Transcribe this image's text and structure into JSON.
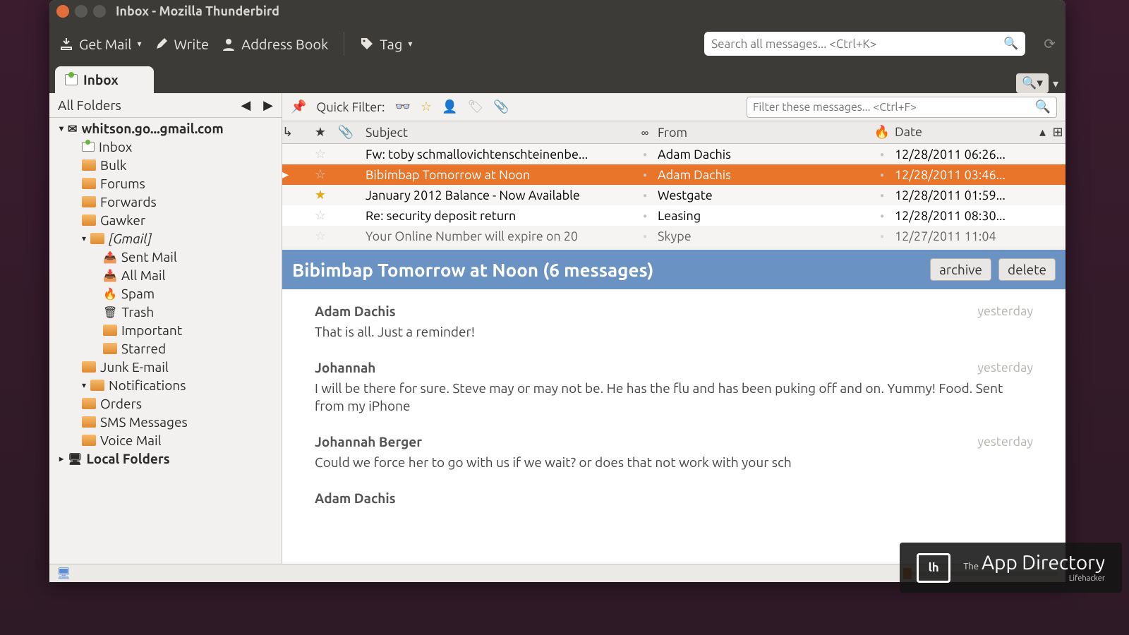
{
  "titlebar": {
    "text": "Inbox - Mozilla Thunderbird"
  },
  "toolbar": {
    "get_mail": "Get Mail",
    "write": "Write",
    "address_book": "Address Book",
    "tag": "Tag",
    "search_placeholder": "Search all messages... <Ctrl+K>"
  },
  "tabstrip": {
    "inbox_label": "Inbox"
  },
  "sidebar": {
    "header": "All Folders",
    "account": "whitson.go...gmail.com",
    "folders": [
      {
        "label": "Inbox",
        "icon": "inbox",
        "depth": 1
      },
      {
        "label": "Bulk",
        "icon": "folder",
        "depth": 1
      },
      {
        "label": "Forums",
        "icon": "folder",
        "depth": 1
      },
      {
        "label": "Forwards",
        "icon": "folder",
        "depth": 1
      },
      {
        "label": "Gawker",
        "icon": "folder",
        "depth": 1
      },
      {
        "label": "[Gmail]",
        "icon": "folder",
        "depth": 1,
        "expandable": true,
        "italic": true
      },
      {
        "label": "Sent Mail",
        "icon": "sent",
        "depth": 2
      },
      {
        "label": "All Mail",
        "icon": "all",
        "depth": 2
      },
      {
        "label": "Spam",
        "icon": "spam",
        "depth": 2
      },
      {
        "label": "Trash",
        "icon": "trash",
        "depth": 2
      },
      {
        "label": "Important",
        "icon": "folder",
        "depth": 2
      },
      {
        "label": "Starred",
        "icon": "folder",
        "depth": 2
      },
      {
        "label": "Junk E-mail",
        "icon": "folder",
        "depth": 1
      },
      {
        "label": "Notifications",
        "icon": "folder",
        "depth": 1,
        "expandable": true
      },
      {
        "label": "Orders",
        "icon": "folder",
        "depth": 1
      },
      {
        "label": "SMS Messages",
        "icon": "folder",
        "depth": 1
      },
      {
        "label": "Voice Mail",
        "icon": "folder",
        "depth": 1
      }
    ],
    "local_folders": "Local Folders"
  },
  "quickfilter": {
    "label": "Quick Filter:",
    "filter_placeholder": "Filter these messages... <Ctrl+F>"
  },
  "columns": {
    "subject": "Subject",
    "from": "From",
    "date": "Date"
  },
  "messages": [
    {
      "star": false,
      "subject": "Fw: toby schmallovichtenschteinenbe...",
      "from": "Adam Dachis",
      "date": "12/28/2011 06:26..."
    },
    {
      "star": false,
      "subject": "Bibimbap Tomorrow at Noon",
      "from": "Adam Dachis",
      "date": "12/28/2011 03:46...",
      "selected": true,
      "thread": true
    },
    {
      "star": true,
      "subject": "January 2012 Balance - Now Available",
      "from": "Westgate",
      "date": "12/28/2011 01:59..."
    },
    {
      "star": false,
      "subject": "Re: security deposit return",
      "from": "Leasing",
      "date": "12/28/2011 08:30..."
    },
    {
      "star": false,
      "subject": "Your Online Number will expire on 20",
      "from": "Skype",
      "date": "12/27/2011 11:04",
      "partial": true
    }
  ],
  "conversation": {
    "title": "Bibimbap Tomorrow at Noon (6 messages)",
    "archive": "archive",
    "delete": "delete",
    "messages": [
      {
        "from": "Adam Dachis",
        "time": "yesterday",
        "text": "That is all. Just a reminder!"
      },
      {
        "from": "Johannah",
        "time": "yesterday",
        "text": "I will be there for sure. Steve may or may not be. He has the flu and has been puking off and on. Yummy! Food. Sent from my iPhone"
      },
      {
        "from": "Johannah Berger",
        "time": "yesterday",
        "text": "Could we force her to go with us if we wait? or does that not work with your sch"
      },
      {
        "from": "Adam Dachis",
        "time": "",
        "text": ""
      }
    ]
  },
  "watermark": {
    "the": "The",
    "main": "App Directory",
    "sub": "Lifehacker",
    "badge": "lh"
  }
}
